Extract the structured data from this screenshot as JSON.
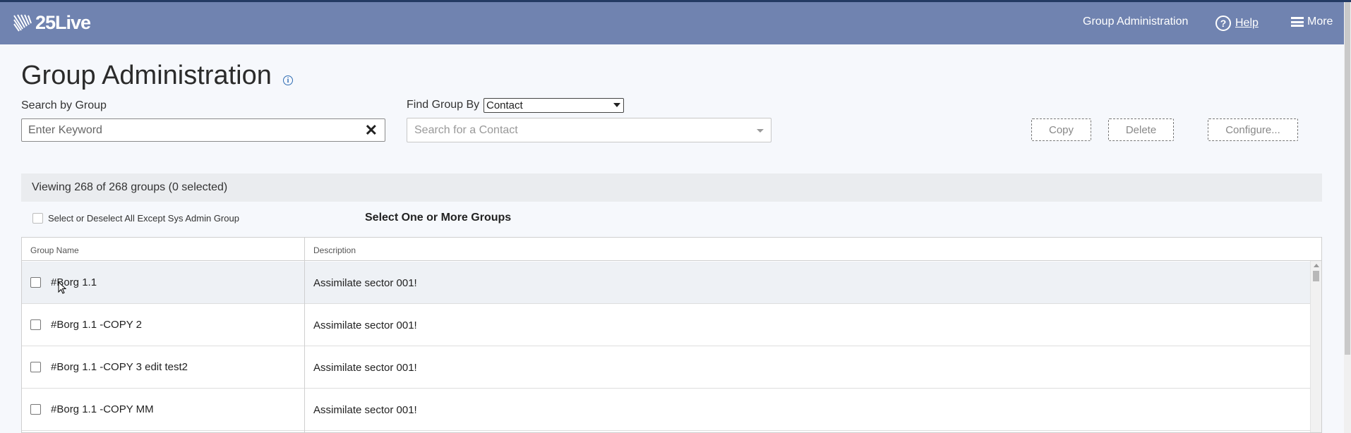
{
  "header": {
    "brand": "25Live",
    "nav_group_admin": "Group Administration",
    "help": "Help",
    "more": "More"
  },
  "page": {
    "title": "Group Administration",
    "search_by_group_label": "Search by Group",
    "search_placeholder": "Enter Keyword",
    "find_group_by_label": "Find Group By",
    "find_group_by_value": "Contact",
    "contact_placeholder": "Search for a Contact",
    "buttons": {
      "copy": "Copy",
      "delete": "Delete",
      "configure": "Configure..."
    }
  },
  "list": {
    "viewing_text": "Viewing 268 of 268 groups (0 selected)",
    "select_all_label": "Select or Deselect All Except Sys Admin Group",
    "select_prompt": "Select One or More Groups",
    "columns": {
      "name": "Group Name",
      "description": "Description"
    },
    "rows": [
      {
        "name": "#Borg 1.1",
        "description": "Assimilate sector 001!"
      },
      {
        "name": "#Borg 1.1 -COPY 2",
        "description": "Assimilate sector 001!"
      },
      {
        "name": "#Borg 1.1 -COPY 3 edit test2",
        "description": "Assimilate sector 001!"
      },
      {
        "name": "#Borg 1.1 -COPY MM",
        "description": "Assimilate sector 001!"
      }
    ]
  },
  "colors": {
    "header_bg": "#7083b0",
    "top_line": "#233a63",
    "info_icon": "#2f6db3"
  },
  "icons": [
    "logo-mark-icon",
    "help-icon",
    "menu-icon",
    "info-icon",
    "clear-icon",
    "dropdown-icon",
    "mouse-cursor-icon"
  ]
}
